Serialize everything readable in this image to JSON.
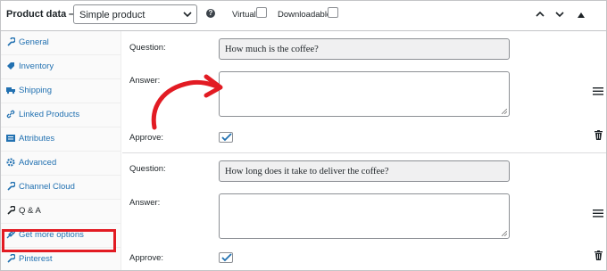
{
  "header": {
    "title": "Product data —",
    "product_type": "Simple product",
    "virtual_label": "Virtual:",
    "downloadable_label": "Downloadable:",
    "icons": [
      "help-icon",
      "chevron-down-icon",
      "arrow-up-icon",
      "arrow-down-icon",
      "collapse-triangle-icon"
    ]
  },
  "sidebar": {
    "items": [
      {
        "label": "General",
        "icon": "wrench-icon"
      },
      {
        "label": "Inventory",
        "icon": "tag-icon"
      },
      {
        "label": "Shipping",
        "icon": "truck-icon"
      },
      {
        "label": "Linked Products",
        "icon": "link-icon"
      },
      {
        "label": "Attributes",
        "icon": "list-icon"
      },
      {
        "label": "Advanced",
        "icon": "gear-icon"
      },
      {
        "label": "Channel Cloud",
        "icon": "wrench-icon"
      },
      {
        "label": "Q & A",
        "icon": "wrench-icon"
      },
      {
        "label": "Get more options",
        "icon": "plug-icon"
      },
      {
        "label": "Pinterest",
        "icon": "wrench-icon"
      }
    ],
    "highlight_color": "#e21b23"
  },
  "qa": [
    {
      "question_label": "Question:",
      "question_value": "How much is the coffee?",
      "answer_label": "Answer:",
      "answer_value": "",
      "approve_label": "Approve:",
      "approved": true
    },
    {
      "question_label": "Question:",
      "question_value": "How long does it take to deliver the coffee?",
      "answer_label": "Answer:",
      "answer_value": "",
      "approve_label": "Approve:",
      "approved": true
    }
  ],
  "colors": {
    "link": "#2271b1",
    "annotation_red": "#e21b23",
    "check_blue": "#2271b1"
  }
}
